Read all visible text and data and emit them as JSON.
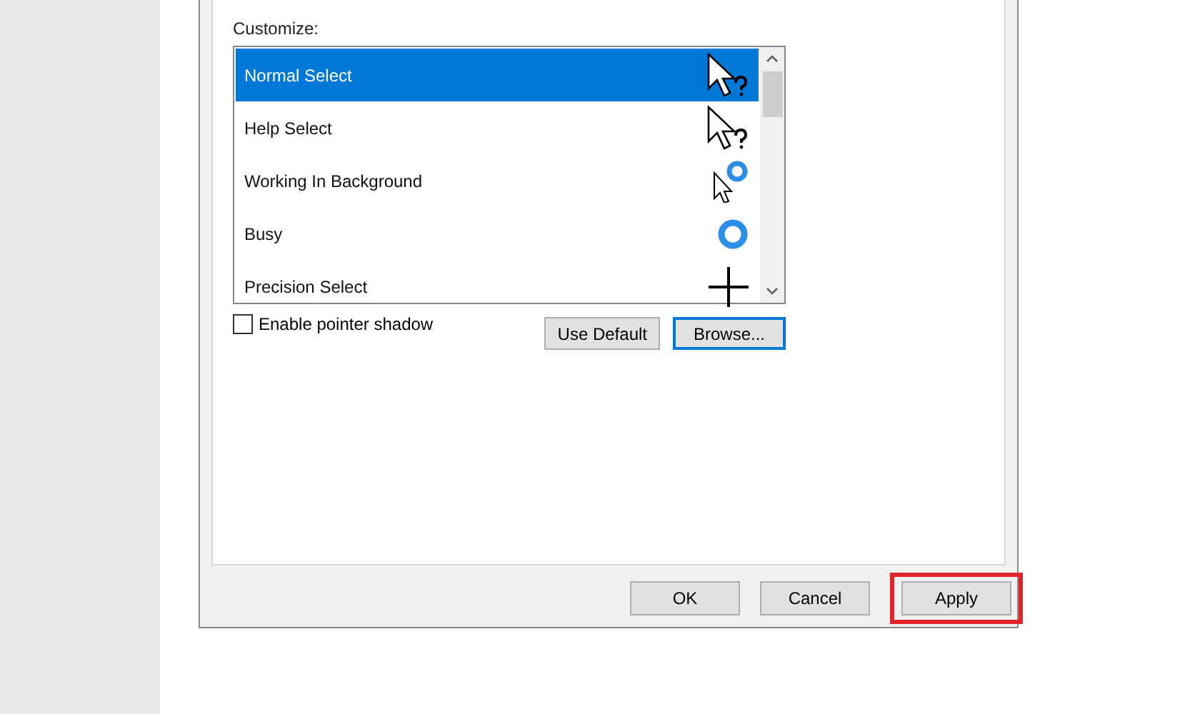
{
  "customize_label": "Customize:",
  "cursors": [
    {
      "name": "Normal Select",
      "kind": "help",
      "selected": true
    },
    {
      "name": "Help Select",
      "kind": "help",
      "selected": false
    },
    {
      "name": "Working In Background",
      "kind": "working",
      "selected": false
    },
    {
      "name": "Busy",
      "kind": "busy",
      "selected": false
    },
    {
      "name": "Precision Select",
      "kind": "cross",
      "selected": false
    }
  ],
  "pointer_shadow": {
    "label": "Enable pointer shadow",
    "checked": false
  },
  "list_buttons": [
    {
      "label": "Use Default",
      "focused": false
    },
    {
      "label": "Browse...",
      "focused": true
    }
  ],
  "dialog_buttons": [
    {
      "label": "OK",
      "highlighted": false
    },
    {
      "label": "Cancel",
      "highlighted": false
    },
    {
      "label": "Apply",
      "highlighted": true
    }
  ]
}
